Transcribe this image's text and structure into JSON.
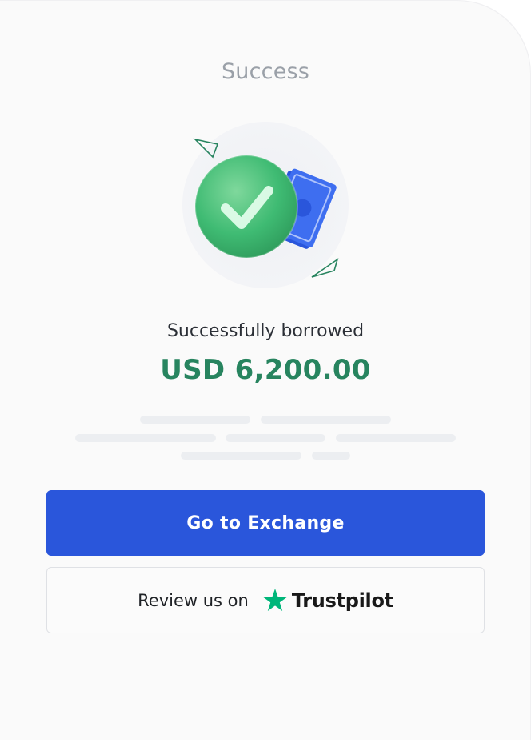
{
  "header": {
    "title": "Success"
  },
  "result": {
    "subtitle": "Successfully borrowed",
    "amount": "USD 6,200.00"
  },
  "actions": {
    "primary_label": "Go to Exchange",
    "review_label": "Review us on",
    "review_brand": "Trustpilot"
  },
  "icons": {
    "hero": "success-check-with-cash-icon",
    "brand": "trustpilot-star-icon"
  },
  "colors": {
    "accent_blue": "#2a56db",
    "amount_green": "#27845f",
    "check_green": "#3fbb73",
    "trustpilot_green": "#00b67a",
    "title_gray": "#9aa0a8"
  }
}
